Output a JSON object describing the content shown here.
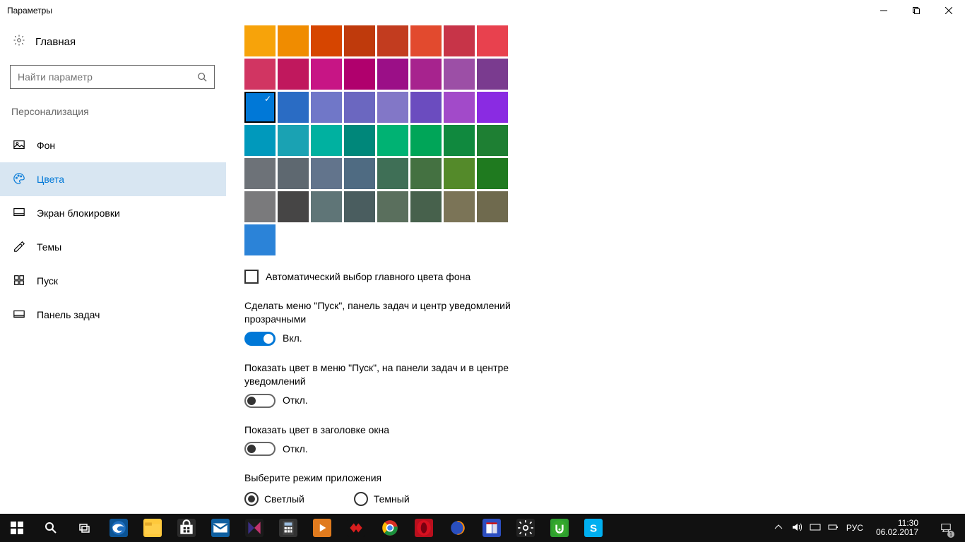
{
  "window_title": "Параметры",
  "home_label": "Главная",
  "search_placeholder": "Найти параметр",
  "group_title": "Персонализация",
  "nav": [
    {
      "id": "background",
      "label": "Фон"
    },
    {
      "id": "colors",
      "label": "Цвета"
    },
    {
      "id": "lockscreen",
      "label": "Экран блокировки"
    },
    {
      "id": "themes",
      "label": "Темы"
    },
    {
      "id": "start",
      "label": "Пуск"
    },
    {
      "id": "taskbar",
      "label": "Панель задач"
    }
  ],
  "selected_nav": "colors",
  "palette": [
    [
      "#f7a30a",
      "#f08c00",
      "#d64500",
      "#bf3a0c",
      "#c23c1f",
      "#e24a2e",
      "#c73448",
      "#e8414e"
    ],
    [
      "#d13562",
      "#c0185d",
      "#c71585",
      "#b0006d",
      "#9b0f87",
      "#a7238e",
      "#9c4fa6",
      "#7a3b8f"
    ],
    [
      "#0078d7",
      "#2a6cc4",
      "#7077c8",
      "#6b67c0",
      "#8277c7",
      "#6b4cbf",
      "#a24ac9",
      "#8a2be2"
    ],
    [
      "#0099bc",
      "#1aa2b3",
      "#00b1a0",
      "#00877a",
      "#00b273",
      "#00a558",
      "#10893e",
      "#1e7f33"
    ],
    [
      "#6d7278",
      "#5e6870",
      "#62748c",
      "#4f6b82",
      "#3f6f56",
      "#447141",
      "#548a2a",
      "#1f7a1f"
    ],
    [
      "#7a7a7c",
      "#464545",
      "#5f7577",
      "#4a5d5f",
      "#5a6f5d",
      "#47614c",
      "#7b7457",
      "#6f6a4e"
    ]
  ],
  "selected_swatch": [
    2,
    0
  ],
  "recent_color": "#2b83d8",
  "checkbox_auto_label": "Автоматический выбор главного цвета фона",
  "checkbox_auto_checked": false,
  "settings": [
    {
      "id": "transparency",
      "label": "Сделать меню \"Пуск\", панель задач и центр уведомлений прозрачными",
      "on": true
    },
    {
      "id": "show-color-start",
      "label": "Показать цвет в меню \"Пуск\", на панели задач и в центре уведомлений",
      "on": false
    },
    {
      "id": "show-color-title",
      "label": "Показать цвет в заголовке окна",
      "on": false
    }
  ],
  "toggle_on_label": "Вкл.",
  "toggle_off_label": "Откл.",
  "app_mode_label": "Выберите режим приложения",
  "app_mode_options": {
    "light": "Светлый",
    "dark": "Темный"
  },
  "app_mode_selected": "light",
  "taskbar_apps": [
    {
      "id": "edge",
      "bg": "#0b5394"
    },
    {
      "id": "explorer",
      "bg": "#ffc93c"
    },
    {
      "id": "store",
      "bg": "#2b2b2b"
    },
    {
      "id": "mail",
      "bg": "#0f5fa0"
    },
    {
      "id": "people",
      "bg": "#1a1a1a"
    },
    {
      "id": "calc",
      "bg": "#333333"
    },
    {
      "id": "media",
      "bg": "#e07b1e"
    },
    {
      "id": "xsplit",
      "bg": "#111111"
    },
    {
      "id": "chrome",
      "bg": "#111111"
    },
    {
      "id": "opera",
      "bg": "#b90f1d"
    },
    {
      "id": "firefox",
      "bg": "#111111"
    },
    {
      "id": "totalcmd",
      "bg": "#2d4ec0"
    },
    {
      "id": "settings",
      "bg": "#222222"
    },
    {
      "id": "utorrent",
      "bg": "#2e9e2e"
    },
    {
      "id": "skype",
      "bg": "#00aff0"
    }
  ],
  "tray": {
    "lang": "РУС",
    "time": "11:30",
    "date": "06.02.2017",
    "notif_count": "1"
  }
}
